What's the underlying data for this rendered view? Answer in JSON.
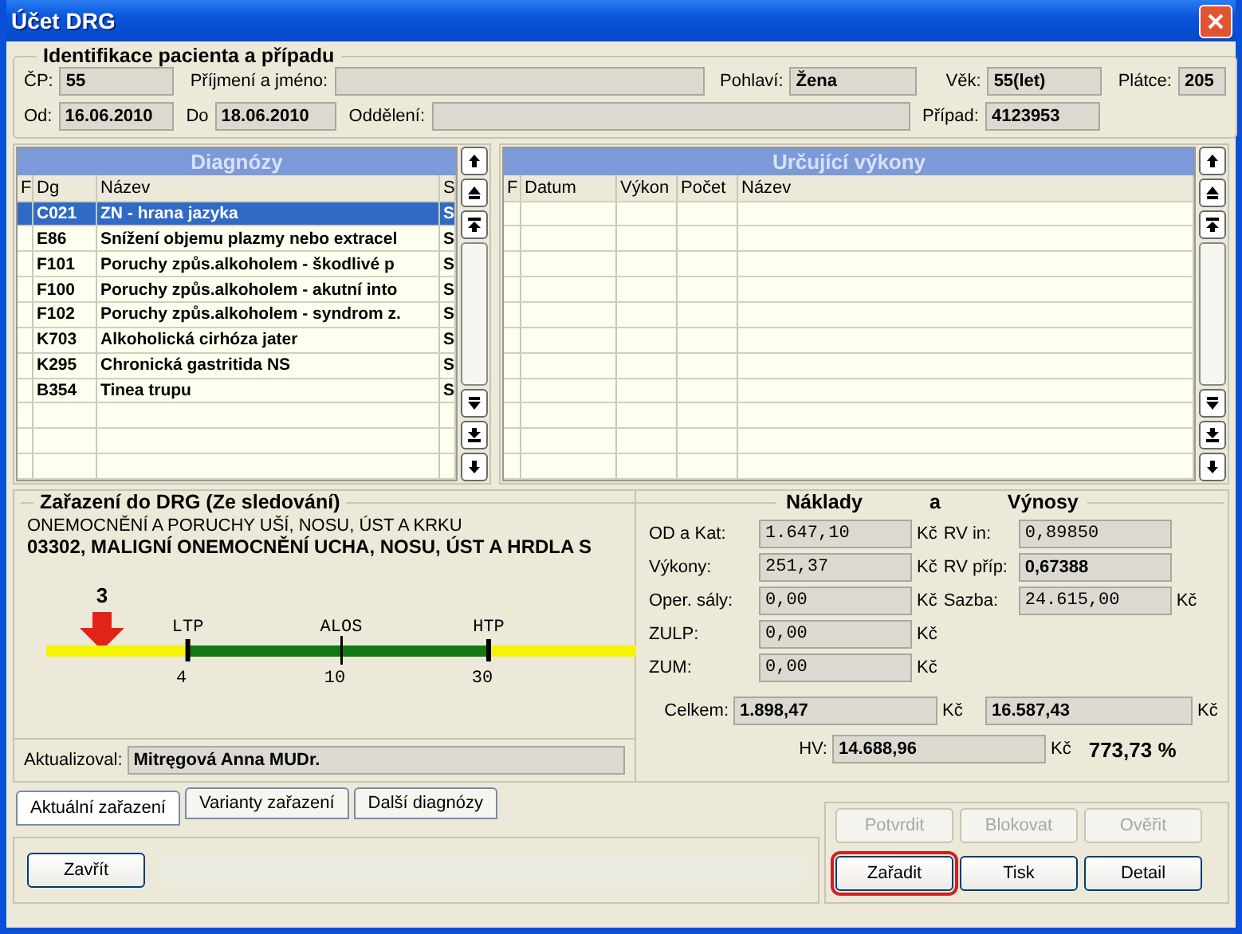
{
  "window": {
    "title": "Účet DRG"
  },
  "patient": {
    "title": "Identifikace pacienta a případu",
    "cp": {
      "label": "ČP:",
      "value": "55"
    },
    "name": {
      "label": "Příjmení a jméno:"
    },
    "sex": {
      "label": "Pohlaví:",
      "value": "Žena"
    },
    "age": {
      "label": "Věk:",
      "value": "55(let)"
    },
    "payer": {
      "label": "Plátce:",
      "value": "205"
    },
    "from": {
      "label": "Od:",
      "value": "16.06.2010"
    },
    "to": {
      "label": "Do",
      "value": "18.06.2010"
    },
    "department": {
      "label": "Oddělení:"
    },
    "case": {
      "label": "Případ:",
      "value": "4123953"
    }
  },
  "diagnoses": {
    "title": "Diagnózy",
    "columns": [
      "F",
      "Dg",
      "Název",
      "S"
    ],
    "rows": [
      {
        "code": "C021",
        "name": "ZN - hrana jazyka",
        "s": "S",
        "selected": true
      },
      {
        "code": "E86",
        "name": "Snížení objemu plazmy nebo extracel",
        "s": "S",
        "selected": false
      },
      {
        "code": "F101",
        "name": "Poruchy  způs.alkoholem - škodlivé p",
        "s": "S",
        "selected": false
      },
      {
        "code": "F100",
        "name": "Poruchy  způs.alkoholem - akutní into",
        "s": "S",
        "selected": false
      },
      {
        "code": "F102",
        "name": "Poruchy  způs.alkoholem - syndrom z.",
        "s": "S",
        "selected": false
      },
      {
        "code": "K703",
        "name": "Alkoholická cirhóza jater",
        "s": "S",
        "selected": false
      },
      {
        "code": "K295",
        "name": "Chronická gastritida NS",
        "s": "S",
        "selected": false
      },
      {
        "code": "B354",
        "name": "Tinea trupu",
        "s": "S",
        "selected": false
      }
    ]
  },
  "procedures": {
    "title": "Určující výkony",
    "columns": [
      "F",
      "Datum",
      "Výkon",
      "Počet",
      "Název"
    ]
  },
  "drg": {
    "title": "Zařazení do DRG (Ze sledování)",
    "group": "ONEMOCNĚNÍ A PORUCHY UŠÍ, NOSU, ÚST A KRKU",
    "name": "03302, MALIGNÍ ONEMOCNĚNÍ UCHA, NOSU, ÚST A HRDLA S",
    "timeline": {
      "marker": "3",
      "ticks": [
        {
          "label": "LTP",
          "value": "4"
        },
        {
          "label": "ALOS",
          "value": "10"
        },
        {
          "label": "HTP",
          "value": "30"
        }
      ]
    },
    "updated_label": "Aktualizoval:",
    "updated_by": "Mitręgová Anna MUDr."
  },
  "finance": {
    "headings": [
      "Náklady",
      "a",
      "Výnosy"
    ],
    "costs": [
      {
        "label": "OD a Kat:",
        "value": "1.647,10",
        "unit": "Kč"
      },
      {
        "label": "Výkony:",
        "value": "251,37",
        "unit": "Kč"
      },
      {
        "label": "Oper. sály:",
        "value": "0,00",
        "unit": "Kč"
      },
      {
        "label": "ZULP:",
        "value": "0,00",
        "unit": "Kč"
      },
      {
        "label": "ZUM:",
        "value": "0,00",
        "unit": "Kč"
      }
    ],
    "revenues": [
      {
        "label": "RV in:",
        "value": "0,89850",
        "bold": false
      },
      {
        "label": "RV příp:",
        "value": "0,67388",
        "bold": true
      },
      {
        "label": "Sazba:",
        "value": "24.615,00",
        "unit": "Kč",
        "bold": false
      }
    ],
    "total": {
      "label": "Celkem:",
      "cost": "1.898,47",
      "cost_unit": "Kč",
      "revenue": "16.587,43",
      "revenue_unit": "Kč"
    },
    "result": {
      "label": "HV:",
      "value": "14.688,96",
      "unit": "Kč",
      "percent": "773,73 %"
    }
  },
  "tabs": [
    {
      "label": "Aktuální zařazení",
      "selected": true
    },
    {
      "label": "Varianty zařazení",
      "selected": false
    },
    {
      "label": "Další diagnózy",
      "selected": false
    }
  ],
  "close_button": "Zavřít",
  "actions": [
    {
      "label": "Potvrdit",
      "disabled": true,
      "focused": false
    },
    {
      "label": "Blokovat",
      "disabled": true,
      "focused": false
    },
    {
      "label": "Ověřit",
      "disabled": true,
      "focused": false
    },
    {
      "label": "Zařadit",
      "disabled": false,
      "focused": true
    },
    {
      "label": "Tisk",
      "disabled": false,
      "focused": false
    },
    {
      "label": "Detail",
      "disabled": false,
      "focused": false
    }
  ]
}
